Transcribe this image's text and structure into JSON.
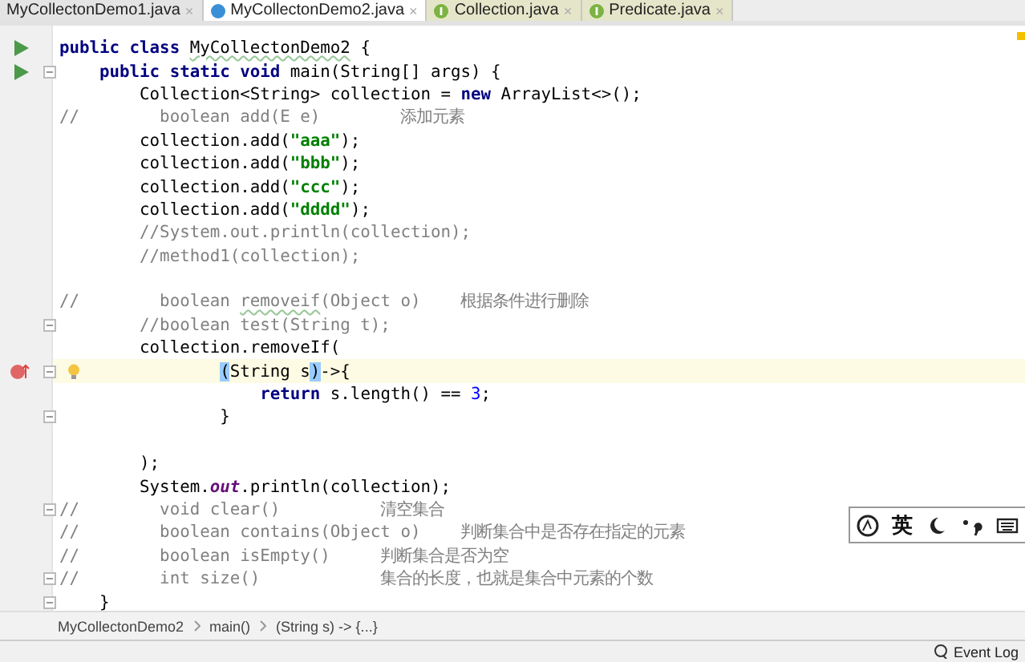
{
  "tabs": [
    {
      "label": "MyCollectonDemo1.java",
      "close": "×",
      "selected": false
    },
    {
      "label": "MyCollectonDemo2.java",
      "close": "×",
      "selected": true,
      "kind": "class"
    },
    {
      "label": "Collection.java",
      "close": "×",
      "selected": false,
      "kind": "interface"
    },
    {
      "label": "Predicate.java",
      "close": "×",
      "selected": false,
      "kind": "interface"
    }
  ],
  "editor": {
    "lines": [
      {
        "kind": "run",
        "fold": false,
        "current": false,
        "segments": [
          {
            "kind": "kw",
            "text": "public class "
          },
          {
            "kind": "typo",
            "text": "MyCollectonDemo2"
          },
          {
            "kind": "plain",
            "text": " {"
          }
        ]
      },
      {
        "kind": "run",
        "fold": true,
        "current": false,
        "segments": [
          {
            "kind": "kw",
            "text": "    public static void "
          },
          {
            "kind": "plain",
            "text": "main(String[] args) {"
          }
        ]
      },
      {
        "fold": false,
        "current": false,
        "segments": [
          {
            "kind": "plain",
            "text": "        Collection<String> collection = "
          },
          {
            "kind": "kw",
            "text": "new "
          },
          {
            "kind": "plain",
            "text": "ArrayList<>();"
          }
        ]
      },
      {
        "fold": false,
        "current": false,
        "segments": [
          {
            "kind": "cmt",
            "text": "//        boolean add(E e)        添加元素"
          }
        ]
      },
      {
        "fold": false,
        "current": false,
        "segments": [
          {
            "kind": "plain",
            "text": "        collection.add("
          },
          {
            "kind": "str",
            "text": "\"aaa\""
          },
          {
            "kind": "plain",
            "text": ");"
          }
        ]
      },
      {
        "fold": false,
        "current": false,
        "segments": [
          {
            "kind": "plain",
            "text": "        collection.add("
          },
          {
            "kind": "str",
            "text": "\"bbb\""
          },
          {
            "kind": "plain",
            "text": ");"
          }
        ]
      },
      {
        "fold": false,
        "current": false,
        "segments": [
          {
            "kind": "plain",
            "text": "        collection.add("
          },
          {
            "kind": "str",
            "text": "\"ccc\""
          },
          {
            "kind": "plain",
            "text": ");"
          }
        ]
      },
      {
        "fold": false,
        "current": false,
        "segments": [
          {
            "kind": "plain",
            "text": "        collection.add("
          },
          {
            "kind": "str",
            "text": "\"dddd\""
          },
          {
            "kind": "plain",
            "text": ");"
          }
        ]
      },
      {
        "fold": false,
        "current": false,
        "segments": [
          {
            "kind": "cmt",
            "text": "        //System.out.println(collection);"
          }
        ]
      },
      {
        "fold": false,
        "current": false,
        "segments": [
          {
            "kind": "cmt",
            "text": "        //method1(collection);"
          }
        ]
      },
      {
        "fold": false,
        "current": false
      },
      {
        "fold": false,
        "current": false,
        "segments": [
          {
            "kind": "cmt",
            "text": "//        boolean "
          },
          {
            "kind": "cmt-typo",
            "text": "removeif"
          },
          {
            "kind": "cmt",
            "text": "(Object o)    根据条件进行删除"
          }
        ]
      },
      {
        "fold": true,
        "current": false,
        "segments": [
          {
            "kind": "cmt",
            "text": "        //boolean test(String t);"
          }
        ]
      },
      {
        "fold": false,
        "current": false,
        "segments": [
          {
            "kind": "plain",
            "text": "        collection.removeIf("
          }
        ]
      },
      {
        "kind": "breakpoint",
        "bulb": true,
        "fold": true,
        "current": true,
        "segments": [
          {
            "kind": "match",
            "text": "                ("
          },
          {
            "kind": "plain",
            "text": "String s"
          },
          {
            "kind": "match",
            "text": ")"
          },
          {
            "kind": "plain",
            "text": "->{"
          }
        ]
      },
      {
        "fold": false,
        "current": false,
        "segments": [
          {
            "kind": "kw",
            "text": "                    return "
          },
          {
            "kind": "plain",
            "text": "s.length() == "
          },
          {
            "kind": "num",
            "text": "3"
          },
          {
            "kind": "plain",
            "text": ";"
          }
        ]
      },
      {
        "fold": true,
        "current": false,
        "segments": [
          {
            "kind": "plain",
            "text": "                }"
          }
        ]
      },
      {
        "fold": false,
        "current": false
      },
      {
        "fold": false,
        "current": false,
        "segments": [
          {
            "kind": "plain",
            "text": "        );"
          }
        ]
      },
      {
        "fold": false,
        "current": false,
        "segments": [
          {
            "kind": "plain",
            "text": "        System."
          },
          {
            "kind": "field",
            "text": "out"
          },
          {
            "kind": "plain",
            "text": ".println(collection);"
          }
        ]
      },
      {
        "fold": true,
        "current": false,
        "segments": [
          {
            "kind": "cmt",
            "text": "//        void clear()          清空集合"
          }
        ]
      },
      {
        "fold": false,
        "current": false,
        "segments": [
          {
            "kind": "cmt",
            "text": "//        boolean contains(Object o)    判断集合中是否存在指定的元素"
          }
        ]
      },
      {
        "fold": false,
        "current": false,
        "segments": [
          {
            "kind": "cmt",
            "text": "//        boolean isEmpty()     判断集合是否为空"
          }
        ]
      },
      {
        "fold": true,
        "current": false,
        "segments": [
          {
            "kind": "cmt",
            "text": "//        int size()            集合的长度，也就是集合中元素的个数"
          }
        ]
      },
      {
        "fold": true,
        "current": false,
        "segments": [
          {
            "kind": "plain",
            "text": "    }"
          }
        ]
      }
    ]
  },
  "ime_toolbar": {
    "language": "英"
  },
  "breadcrumbs": [
    "MyCollectonDemo2",
    "main()",
    "(String s) -> {...}"
  ],
  "status_bar": {
    "event_log": "Event Log"
  }
}
